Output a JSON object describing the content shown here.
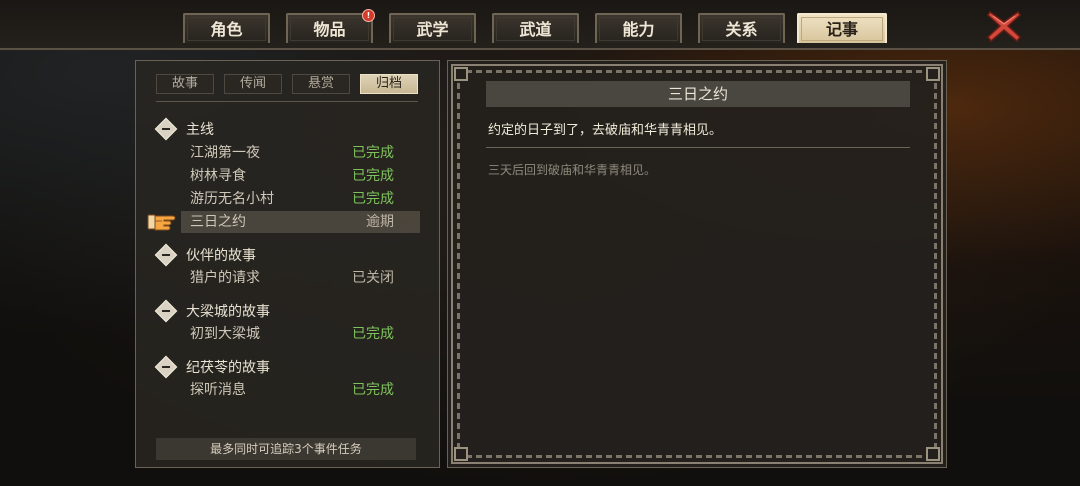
{
  "tabs": [
    {
      "label": "角色",
      "active": false
    },
    {
      "label": "物品",
      "active": false,
      "badge": "!"
    },
    {
      "label": "武学",
      "active": false
    },
    {
      "label": "武道",
      "active": false
    },
    {
      "label": "能力",
      "active": false
    },
    {
      "label": "关系",
      "active": false
    },
    {
      "label": "记事",
      "active": true
    }
  ],
  "subtabs": [
    {
      "label": "故事",
      "active": false
    },
    {
      "label": "传闻",
      "active": false
    },
    {
      "label": "悬赏",
      "active": false
    },
    {
      "label": "归档",
      "active": true
    }
  ],
  "groups": [
    {
      "title": "主线",
      "quests": [
        {
          "name": "江湖第一夜",
          "status": "已完成"
        },
        {
          "name": "树林寻食",
          "status": "已完成"
        },
        {
          "name": "游历无名小村",
          "status": "已完成"
        },
        {
          "name": "三日之约",
          "status": "逾期",
          "selected": true
        }
      ]
    },
    {
      "title": "伙伴的故事",
      "quests": [
        {
          "name": "猎户的请求",
          "status": "已关闭"
        }
      ]
    },
    {
      "title": "大梁城的故事",
      "quests": [
        {
          "name": "初到大梁城",
          "status": "已完成"
        }
      ]
    },
    {
      "title": "纪茯苓的故事",
      "quests": [
        {
          "name": "探听消息",
          "status": "已完成"
        }
      ]
    }
  ],
  "footer_note": "最多同时可追踪3个事件任务",
  "detail": {
    "title": "三日之约",
    "description": "约定的日子到了，去破庙和华青青相见。",
    "objective": "三天后回到破庙和华青青相见。"
  },
  "colors": {
    "completed": "#7ec25b",
    "accent_tab": "#e3d3ad",
    "close": "#d2483a"
  },
  "icons": {
    "close": "close-x-icon",
    "pointer": "hand-pointer-icon",
    "collapse": "collapse-diamond-icon"
  }
}
